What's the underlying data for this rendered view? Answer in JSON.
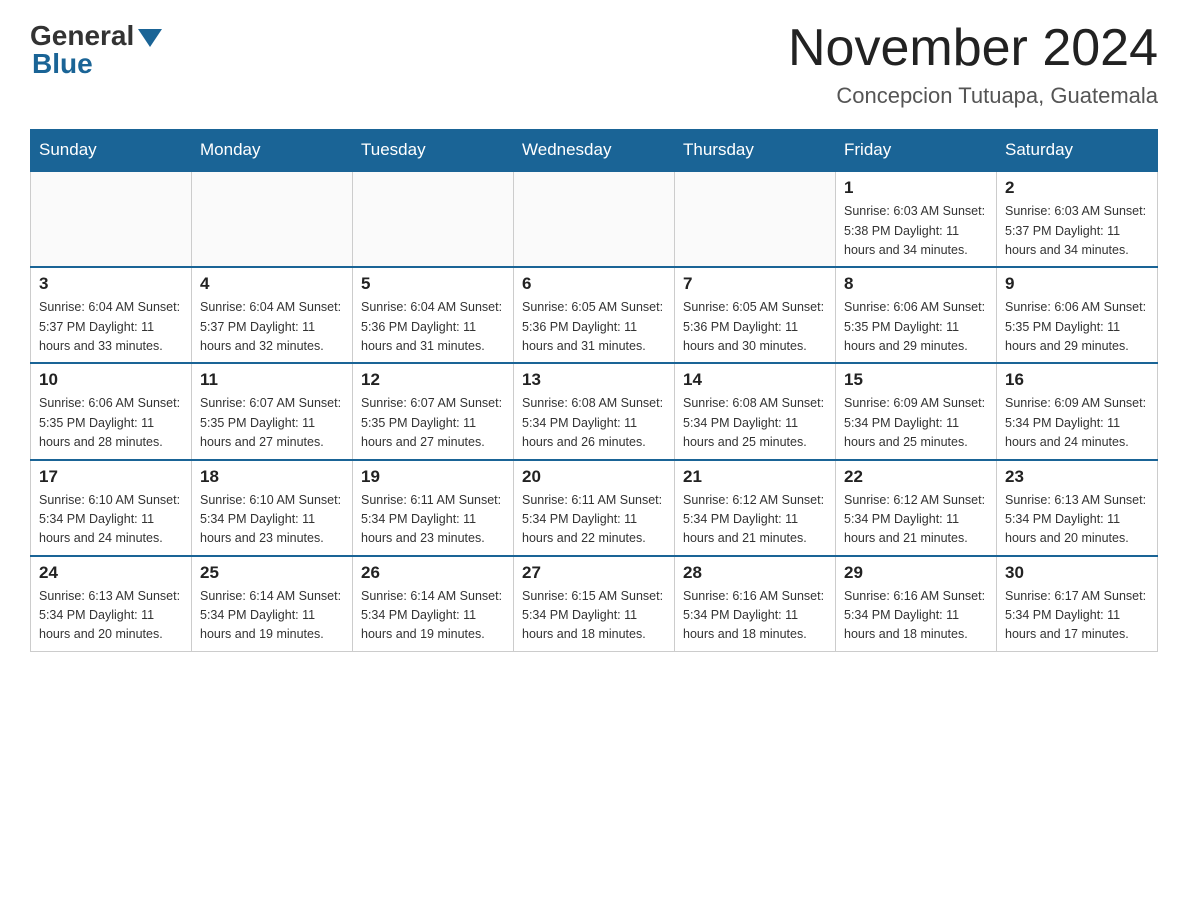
{
  "logo": {
    "general": "General",
    "blue": "Blue"
  },
  "header": {
    "month_title": "November 2024",
    "location": "Concepcion Tutuapa, Guatemala"
  },
  "weekdays": [
    "Sunday",
    "Monday",
    "Tuesday",
    "Wednesday",
    "Thursday",
    "Friday",
    "Saturday"
  ],
  "weeks": [
    [
      {
        "day": "",
        "info": ""
      },
      {
        "day": "",
        "info": ""
      },
      {
        "day": "",
        "info": ""
      },
      {
        "day": "",
        "info": ""
      },
      {
        "day": "",
        "info": ""
      },
      {
        "day": "1",
        "info": "Sunrise: 6:03 AM\nSunset: 5:38 PM\nDaylight: 11 hours and 34 minutes."
      },
      {
        "day": "2",
        "info": "Sunrise: 6:03 AM\nSunset: 5:37 PM\nDaylight: 11 hours and 34 minutes."
      }
    ],
    [
      {
        "day": "3",
        "info": "Sunrise: 6:04 AM\nSunset: 5:37 PM\nDaylight: 11 hours and 33 minutes."
      },
      {
        "day": "4",
        "info": "Sunrise: 6:04 AM\nSunset: 5:37 PM\nDaylight: 11 hours and 32 minutes."
      },
      {
        "day": "5",
        "info": "Sunrise: 6:04 AM\nSunset: 5:36 PM\nDaylight: 11 hours and 31 minutes."
      },
      {
        "day": "6",
        "info": "Sunrise: 6:05 AM\nSunset: 5:36 PM\nDaylight: 11 hours and 31 minutes."
      },
      {
        "day": "7",
        "info": "Sunrise: 6:05 AM\nSunset: 5:36 PM\nDaylight: 11 hours and 30 minutes."
      },
      {
        "day": "8",
        "info": "Sunrise: 6:06 AM\nSunset: 5:35 PM\nDaylight: 11 hours and 29 minutes."
      },
      {
        "day": "9",
        "info": "Sunrise: 6:06 AM\nSunset: 5:35 PM\nDaylight: 11 hours and 29 minutes."
      }
    ],
    [
      {
        "day": "10",
        "info": "Sunrise: 6:06 AM\nSunset: 5:35 PM\nDaylight: 11 hours and 28 minutes."
      },
      {
        "day": "11",
        "info": "Sunrise: 6:07 AM\nSunset: 5:35 PM\nDaylight: 11 hours and 27 minutes."
      },
      {
        "day": "12",
        "info": "Sunrise: 6:07 AM\nSunset: 5:35 PM\nDaylight: 11 hours and 27 minutes."
      },
      {
        "day": "13",
        "info": "Sunrise: 6:08 AM\nSunset: 5:34 PM\nDaylight: 11 hours and 26 minutes."
      },
      {
        "day": "14",
        "info": "Sunrise: 6:08 AM\nSunset: 5:34 PM\nDaylight: 11 hours and 25 minutes."
      },
      {
        "day": "15",
        "info": "Sunrise: 6:09 AM\nSunset: 5:34 PM\nDaylight: 11 hours and 25 minutes."
      },
      {
        "day": "16",
        "info": "Sunrise: 6:09 AM\nSunset: 5:34 PM\nDaylight: 11 hours and 24 minutes."
      }
    ],
    [
      {
        "day": "17",
        "info": "Sunrise: 6:10 AM\nSunset: 5:34 PM\nDaylight: 11 hours and 24 minutes."
      },
      {
        "day": "18",
        "info": "Sunrise: 6:10 AM\nSunset: 5:34 PM\nDaylight: 11 hours and 23 minutes."
      },
      {
        "day": "19",
        "info": "Sunrise: 6:11 AM\nSunset: 5:34 PM\nDaylight: 11 hours and 23 minutes."
      },
      {
        "day": "20",
        "info": "Sunrise: 6:11 AM\nSunset: 5:34 PM\nDaylight: 11 hours and 22 minutes."
      },
      {
        "day": "21",
        "info": "Sunrise: 6:12 AM\nSunset: 5:34 PM\nDaylight: 11 hours and 21 minutes."
      },
      {
        "day": "22",
        "info": "Sunrise: 6:12 AM\nSunset: 5:34 PM\nDaylight: 11 hours and 21 minutes."
      },
      {
        "day": "23",
        "info": "Sunrise: 6:13 AM\nSunset: 5:34 PM\nDaylight: 11 hours and 20 minutes."
      }
    ],
    [
      {
        "day": "24",
        "info": "Sunrise: 6:13 AM\nSunset: 5:34 PM\nDaylight: 11 hours and 20 minutes."
      },
      {
        "day": "25",
        "info": "Sunrise: 6:14 AM\nSunset: 5:34 PM\nDaylight: 11 hours and 19 minutes."
      },
      {
        "day": "26",
        "info": "Sunrise: 6:14 AM\nSunset: 5:34 PM\nDaylight: 11 hours and 19 minutes."
      },
      {
        "day": "27",
        "info": "Sunrise: 6:15 AM\nSunset: 5:34 PM\nDaylight: 11 hours and 18 minutes."
      },
      {
        "day": "28",
        "info": "Sunrise: 6:16 AM\nSunset: 5:34 PM\nDaylight: 11 hours and 18 minutes."
      },
      {
        "day": "29",
        "info": "Sunrise: 6:16 AM\nSunset: 5:34 PM\nDaylight: 11 hours and 18 minutes."
      },
      {
        "day": "30",
        "info": "Sunrise: 6:17 AM\nSunset: 5:34 PM\nDaylight: 11 hours and 17 minutes."
      }
    ]
  ]
}
